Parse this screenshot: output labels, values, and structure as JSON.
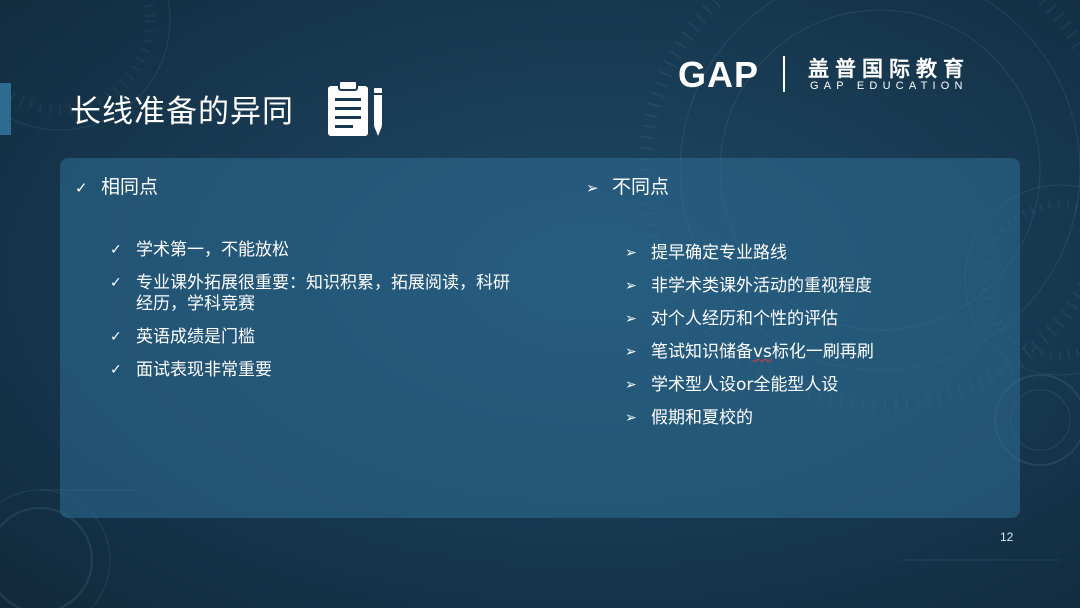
{
  "slide": {
    "title": "长线准备的异同",
    "page_number": "12"
  },
  "logo": {
    "brand": "GAP",
    "cn_name": "盖普国际教育",
    "en_name": "GAP EDUCATION"
  },
  "same": {
    "heading": "相同点",
    "marker": "✓",
    "items": [
      "学术第一，不能放松",
      "专业课外拓展很重要：知识积累，拓展阅读，科研经历，学科竞赛",
      "英语成绩是门槛",
      "面试表现非常重要"
    ]
  },
  "different": {
    "heading": "不同点",
    "marker": "➢",
    "items": [
      "提早确定专业路线",
      "非学术类课外活动的重视程度",
      "对个人经历和个性的评估",
      "笔试知识储备vs标化一刷再刷",
      "学术型人设or全能型人设",
      "假期和夏校的"
    ],
    "item4_parts": [
      "笔试知识储备",
      "vs",
      "标化一刷再刷"
    ]
  },
  "icons": {
    "clipboard": "clipboard-pencil-icon",
    "check": "checkmark-icon",
    "arrow": "arrowhead-bullet-icon"
  },
  "colors": {
    "background": "#17384f",
    "panel": "#2d6e96",
    "accent_bar": "#2d6b91",
    "spellcheck": "#e23a3a"
  }
}
